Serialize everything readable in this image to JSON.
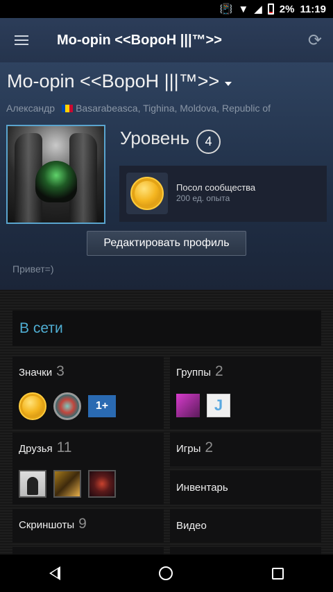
{
  "status_bar": {
    "battery": "2%",
    "time": "11:19"
  },
  "app_bar": {
    "title": "Mo-opin <<ВороН |||™>>"
  },
  "profile": {
    "name": "Mo-opin <<ВороН |||™>>",
    "real_name": "Александр",
    "location": "Basarabeasca, Tighina, Moldova, Republic of",
    "level_label": "Уровень",
    "level": "4",
    "badge": {
      "title": "Посол сообщества",
      "xp": "200 ед. опыта"
    },
    "edit_button": "Редактировать профиль",
    "summary": "Привет=)"
  },
  "status": "В сети",
  "sections": {
    "badges": {
      "label": "Значки",
      "count": "3"
    },
    "groups": {
      "label": "Группы",
      "count": "2"
    },
    "friends": {
      "label": "Друзья",
      "count": "11"
    },
    "games": {
      "label": "Игры",
      "count": "2"
    },
    "inventory": {
      "label": "Инвентарь"
    },
    "screenshots": {
      "label": "Скриншоты",
      "count": "9"
    },
    "videos": {
      "label": "Видео"
    }
  },
  "badge_icons": [
    "community-ambassador-coin",
    "globe-badge",
    "1+ badge"
  ],
  "badge_3_text": "1+",
  "group_2_text": "J",
  "colors": {
    "accent": "#4faed3",
    "app_bar": "#2c3d59",
    "avatar_border": "#5aa5cf"
  }
}
